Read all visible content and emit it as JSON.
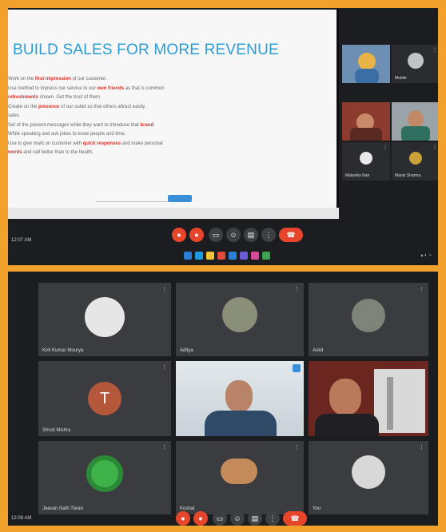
{
  "colors": {
    "frame": "#f2a22c",
    "panel_bg": "#1b1d20",
    "tile_bg": "#3a3c40",
    "slide_title": "#2b9ed6",
    "highlight": "#d9352b",
    "end_call": "#e8462c"
  },
  "presentation": {
    "title": "BUILD SALES FOR MORE REVENUE",
    "lines": [
      {
        "pre": "Work on the ",
        "hl": "first impression",
        "post": " of our customer."
      },
      {
        "pre": "Use method to impress our service to our ",
        "hl": "own friends",
        "post": " as that is common"
      },
      {
        "pre": "",
        "hl": "refreshments",
        "post": " shown. Get the trust of them"
      },
      {
        "pre": "Create on the ",
        "hl": "presence",
        "post": " of our outlet so that others attract easily."
      },
      {
        "pre": "sales",
        "hl": "",
        "post": ""
      },
      {
        "pre": "Set of the present messages while they want to introduce that ",
        "hl": "brand",
        "post": "."
      },
      {
        "pre": "While speaking and ask jokes to know people and time.",
        "hl": "",
        "post": ""
      },
      {
        "pre": "Use to give mark on customer with ",
        "hl": "quick responses",
        "post": " and make personal"
      },
      {
        "pre": "",
        "hl": "words",
        "post": " and call better than to the health."
      }
    ]
  },
  "sidebar_thumbs": [
    {
      "label": "",
      "icon": "person-video"
    },
    {
      "label": "Mobile",
      "icon": "user-avatar"
    },
    {
      "label": "",
      "icon": "person-video"
    },
    {
      "label": "",
      "icon": "person-video"
    },
    {
      "label": "Malavika Nair",
      "icon": "user-avatar"
    },
    {
      "label": "Mansi Sharma",
      "icon": "user-avatar"
    }
  ],
  "controls": [
    "mic-off",
    "camera-off",
    "present",
    "emoji",
    "chat",
    "more",
    "end-call"
  ],
  "top_corner_label": "12:07 AM",
  "bottom_corner_label": "12:08 AM",
  "grid_tiles": [
    {
      "name": "Kirti Kumar Mourya",
      "type": "avatar-image"
    },
    {
      "name": "Aditya",
      "type": "avatar-image"
    },
    {
      "name": "Ankit",
      "type": "avatar-image"
    },
    {
      "name": "Shruti Mishra",
      "type": "initial",
      "initial": "T"
    },
    {
      "name": "",
      "type": "video-man"
    },
    {
      "name": "",
      "type": "video-woman"
    },
    {
      "name": "Jeevan Nath Tiwari",
      "type": "avatar-green"
    },
    {
      "name": "Koshal",
      "type": "avatar-image"
    },
    {
      "name": "You",
      "type": "avatar-image"
    }
  ]
}
